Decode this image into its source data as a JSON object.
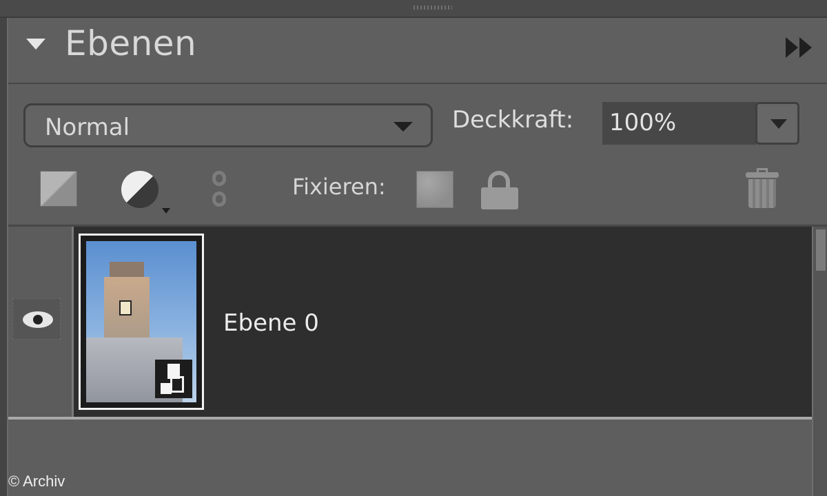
{
  "panel": {
    "title": "Ebenen",
    "collapse_icon": "collapse-triangle-icon",
    "menu_icon": "panel-menu-arrows-icon"
  },
  "controls": {
    "blend_mode": "Normal",
    "opacity_label": "Deckkraft:",
    "opacity_value": "100%"
  },
  "tools": {
    "lock_label": "Fixieren:",
    "icons": [
      "new-layer-icon",
      "adjustment-layer-icon",
      "link-layers-icon",
      "lock-transparent-pixels-icon",
      "lock-all-icon",
      "delete-layer-icon"
    ]
  },
  "layers": [
    {
      "name": "Ebene 0",
      "visible": true,
      "selected": true,
      "thumbnail": "clock-tower-photo",
      "badge": "smart-object-icon"
    }
  ],
  "footer": {
    "copyright": "© Archiv"
  },
  "colors": {
    "panel_bg": "#5e5e5e",
    "selected_row": "#2e2e2e",
    "text": "#dadada"
  }
}
